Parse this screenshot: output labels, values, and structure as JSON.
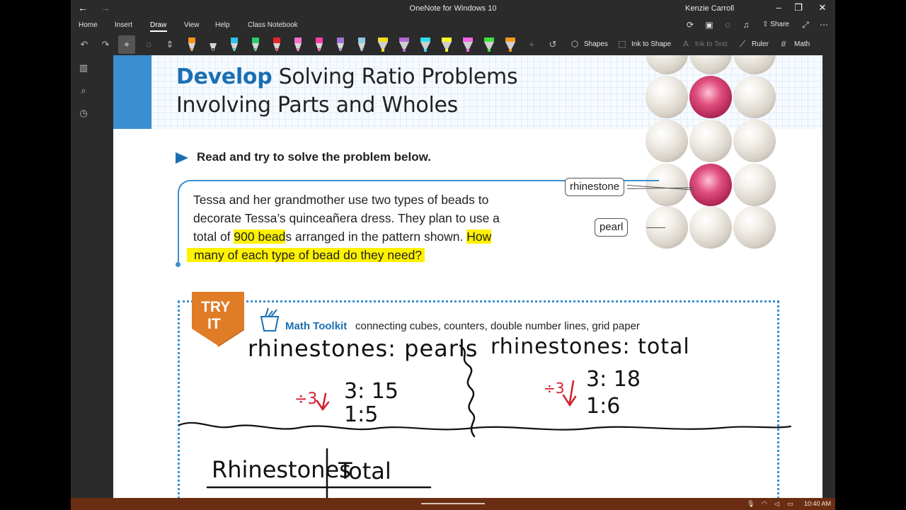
{
  "window": {
    "title": "OneNote for Windows 10",
    "user": "Kenzie Carroll",
    "back_glyph": "←",
    "forward_glyph": "→"
  },
  "menu": {
    "items": [
      "Home",
      "Insert",
      "Draw",
      "View",
      "Help",
      "Class Notebook"
    ],
    "active": "Draw",
    "share": "Share"
  },
  "toolbar": {
    "shapes": "Shapes",
    "ink_to_shape": "Ink to Shape",
    "ink_to_text": "Ink to Text",
    "ruler": "Ruler",
    "math": "Math",
    "pen_colors": [
      "#f7941d",
      "#2b2b2b",
      "#2ec4e8",
      "#2ecc71",
      "#e8242c",
      "#ff6ec7",
      "#ff3fa4",
      "#a374d6",
      "#8ecae6",
      "#f4e01f",
      "#b26bd6",
      "#2de0f0",
      "#f5ff2a",
      "#ff66e6",
      "#3ee23e",
      "#f79a1d"
    ]
  },
  "page": {
    "title_bold": "Develop",
    "title_line1": " Solving Ratio Problems",
    "title_line2": "Involving Parts and Wholes",
    "instruction": "Read and try to solve the problem below.",
    "problem_line1": "Tessa and her grandmother use two types of beads to",
    "problem_line2": "decorate Tessa’s quinceañera dress. They plan to use a",
    "problem_line3_pre": "total of ",
    "problem_line3_hl": "900 bead",
    "problem_line3_mid": "s arranged in the pattern shown. ",
    "problem_line3_hl2": "How",
    "problem_line4": "many of each type of bead do they need?",
    "callout_rhinestone": "rhinestone",
    "callout_pearl": "pearl",
    "try_it_1": "TRY",
    "try_it_2": "IT",
    "toolkit_title": "Math Toolkit",
    "toolkit_text": "connecting cubes, counters, double number lines, grid paper"
  },
  "ink": {
    "left_heading": "rhinestones: pearls",
    "right_heading": "rhinestones: total",
    "div_left": "÷3",
    "div_right": "÷3",
    "left_r1": "3: 15",
    "left_r2": "1:5",
    "right_r1": "3: 18",
    "right_r2": "1:6",
    "table_col1": "Rhinestones",
    "table_col2": "Total"
  },
  "tray": {
    "time": "10:40 AM"
  }
}
